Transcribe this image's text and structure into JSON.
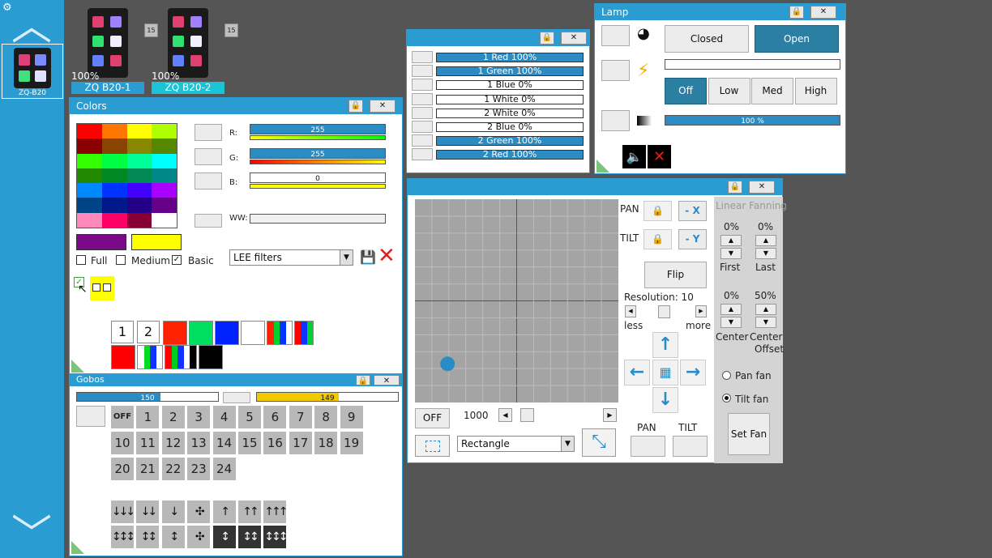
{
  "sidebar": {
    "fixture_label": "ZQ-B20"
  },
  "fixtures": [
    {
      "name": "ZQ B20-1",
      "badge": "15",
      "percent": "100%",
      "color": "#2b9cd1"
    },
    {
      "name": "ZQ B20-2",
      "badge": "15",
      "percent": "100%",
      "color": "#1bc3d6"
    }
  ],
  "colors": {
    "title": "Colors",
    "r_label": "R:",
    "g_label": "G:",
    "b_label": "B:",
    "ww_label": "WW:",
    "r_value": "255",
    "g_value": "255",
    "b_value": "0",
    "r_fraction": 1.0,
    "g_fraction": 1.0,
    "b_fraction": 0.0,
    "ww_fraction": 0.0,
    "picked_colors": [
      "#7b0a8a",
      "#ffff00"
    ],
    "options": [
      "Full",
      "Medium",
      "Basic"
    ],
    "options_checked": [
      false,
      false,
      true
    ],
    "filter_select": "LEE filters",
    "palette": [
      "#ff0000",
      "#ff7700",
      "#ffff00",
      "#b0ff00",
      "#8a0000",
      "#884400",
      "#888800",
      "#558800",
      "#33ff00",
      "#00ff44",
      "#00ff99",
      "#00ffff",
      "#228800",
      "#008822",
      "#008855",
      "#008888",
      "#0088ff",
      "#0033ff",
      "#4400ff",
      "#aa00ff",
      "#004488",
      "#001888",
      "#220088",
      "#660088",
      "#ff88bb",
      "#ff0066",
      "#880033",
      "#ffffff"
    ],
    "macro_numbers": [
      "1",
      "2"
    ],
    "macro_swatches_row1": [
      [
        "#ff2200"
      ],
      [
        "#00e060"
      ],
      [
        "#0022ff"
      ],
      [
        "#ffffff"
      ],
      [
        "#ff2200",
        "#00d030",
        "#0033ff",
        "#ffffff"
      ],
      [
        "#ff0000",
        "#1133ff",
        "#00d030"
      ]
    ],
    "macro_swatches_row2": [
      [
        "#ff0000"
      ],
      [
        "#ffffff",
        "#00dd22",
        "#1133ff",
        "#ffffff"
      ],
      [
        "#ff0000",
        "#00cc22",
        "#1133ff",
        "#ffffff",
        "#000000"
      ],
      [
        "#000000"
      ]
    ]
  },
  "gobos": {
    "title": "Gobos",
    "bar1_value": "150",
    "bar1_fraction": 0.59,
    "bar2_value": "149",
    "bar2_fraction": 0.58,
    "bar2_color": "#f2c800",
    "off_label": "OFF",
    "numbers": [
      "1",
      "2",
      "3",
      "4",
      "5",
      "6",
      "7",
      "8",
      "9",
      "10",
      "11",
      "12",
      "13",
      "14",
      "15",
      "16",
      "17",
      "18",
      "19",
      "20",
      "21",
      "22",
      "23",
      "24"
    ],
    "arrow_row1": [
      "↓↓↓",
      "↓↓",
      "↓",
      "✣",
      "↑",
      "↑↑",
      "↑↑↑"
    ],
    "arrow_row2": [
      "↕↕↕",
      "↕↕",
      "↕",
      "✣",
      "↕",
      "↕↕",
      "↕↕↕"
    ]
  },
  "channels": [
    {
      "label": "1 Red",
      "value": "100%",
      "on": true
    },
    {
      "label": "1 Green",
      "value": "100%",
      "on": true
    },
    {
      "label": "1 Blue",
      "value": "0%",
      "on": false
    },
    {
      "label": "1 White",
      "value": "0%",
      "on": false
    },
    {
      "label": "2 White",
      "value": "0%",
      "on": false
    },
    {
      "label": "2 Blue",
      "value": "0%",
      "on": false
    },
    {
      "label": "2 Green",
      "value": "100%",
      "on": true
    },
    {
      "label": "2 Red",
      "value": "100%",
      "on": true
    }
  ],
  "lamp": {
    "title": "Lamp",
    "closed_label": "Closed",
    "open_label": "Open",
    "power_levels": [
      "Off",
      "Low",
      "Med",
      "High"
    ],
    "dimmer_value": "100 %",
    "dimmer_fraction": 1.0
  },
  "position": {
    "pan_label": "PAN",
    "tilt_label": "TILT",
    "minus_x": "- X",
    "minus_y": "- Y",
    "flip_label": "Flip",
    "resolution_label": "Resolution: 10",
    "less_label": "less",
    "more_label": "more",
    "off_label": "OFF",
    "speed_value": "1000",
    "shape_select": "Rectangle",
    "pan_bottom_label": "PAN",
    "tilt_bottom_label": "TILT",
    "fan_header": "Linear Fanning",
    "first_pct": "0%",
    "last_pct": "0%",
    "first_label": "First",
    "last_label": "Last",
    "center_pct": "0%",
    "offset_pct": "50%",
    "center_label": "Center",
    "offset_label_1": "Center",
    "offset_label_2": "Offset",
    "pan_fan_label": "Pan fan",
    "tilt_fan_label": "Tilt fan",
    "tilt_fan_selected": true,
    "set_fan_label": "Set Fan",
    "dot_x_fraction": 0.16,
    "dot_y_fraction": 0.81
  }
}
